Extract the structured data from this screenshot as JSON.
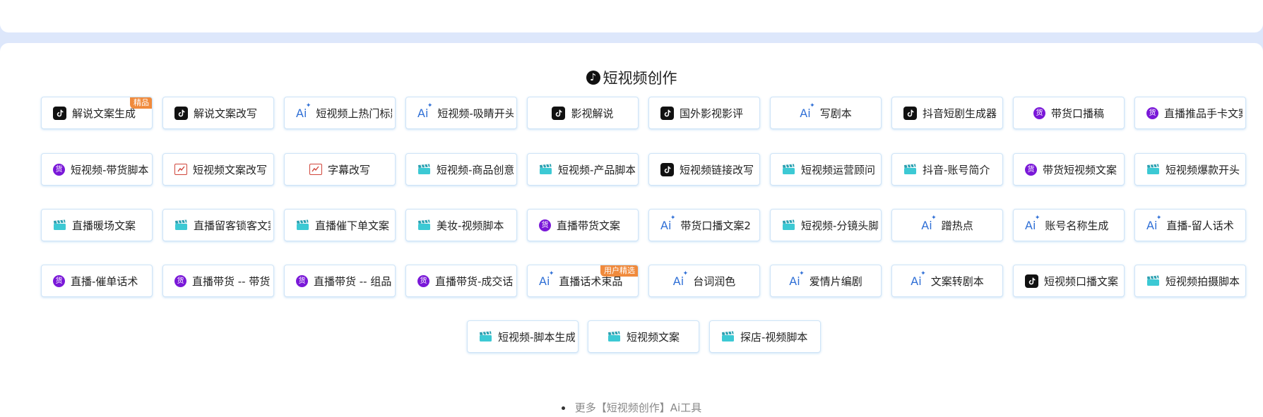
{
  "section": {
    "title": "短视频创作"
  },
  "badges": {
    "featured": "精品",
    "user_featured": "用户精选"
  },
  "tools": [
    {
      "label": "解说文案生成",
      "icon": "tiktok-icon",
      "badge": "featured"
    },
    {
      "label": "解说文案改写",
      "icon": "tiktok-icon"
    },
    {
      "label": "短视频上热门标题",
      "icon": "ai-sparkle-icon"
    },
    {
      "label": "短视频-吸睛开头",
      "icon": "ai-sparkle-icon"
    },
    {
      "label": "影视解说",
      "icon": "tiktok-icon",
      "center": true
    },
    {
      "label": "国外影视影评",
      "icon": "tiktok-icon"
    },
    {
      "label": "写剧本",
      "icon": "ai-sparkle-icon",
      "center": true
    },
    {
      "label": "抖音短剧生成器",
      "icon": "tiktok-icon"
    },
    {
      "label": "带货口播稿",
      "icon": "goods-icon",
      "center": true
    },
    {
      "label": "直播推品手卡文案",
      "icon": "goods-icon"
    },
    {
      "label": "短视频-带货脚本",
      "icon": "goods-icon"
    },
    {
      "label": "短视频文案改写",
      "icon": "edit-icon"
    },
    {
      "label": "字幕改写",
      "icon": "edit-icon",
      "center": true
    },
    {
      "label": "短视频-商品创意",
      "icon": "clapper-icon"
    },
    {
      "label": "短视频-产品脚本",
      "icon": "clapper-icon"
    },
    {
      "label": "短视频链接改写",
      "icon": "tiktok-icon"
    },
    {
      "label": "短视频运营顾问",
      "icon": "clapper-icon"
    },
    {
      "label": "抖音-账号简介",
      "icon": "clapper-icon"
    },
    {
      "label": "带货短视频文案",
      "icon": "goods-icon"
    },
    {
      "label": "短视频爆款开头",
      "icon": "clapper-icon"
    },
    {
      "label": "直播暖场文案",
      "icon": "clapper-icon"
    },
    {
      "label": "直播留客锁客文案",
      "icon": "clapper-icon"
    },
    {
      "label": "直播催下单文案",
      "icon": "clapper-icon"
    },
    {
      "label": "美妆-视频脚本",
      "icon": "clapper-icon"
    },
    {
      "label": "直播带货文案",
      "icon": "goods-icon"
    },
    {
      "label": "带货口播文案2",
      "icon": "ai-sparkle-icon"
    },
    {
      "label": "短视频-分镜头脚本",
      "icon": "clapper-icon"
    },
    {
      "label": "蹭热点",
      "icon": "ai-sparkle-icon",
      "center": true
    },
    {
      "label": "账号名称生成",
      "icon": "ai-sparkle-icon"
    },
    {
      "label": "直播-留人话术",
      "icon": "ai-sparkle-icon"
    },
    {
      "label": "直播-催单话术",
      "icon": "goods-icon"
    },
    {
      "label": "直播带货 -- 带货话术",
      "icon": "goods-icon"
    },
    {
      "label": "直播带货 -- 组品话术",
      "icon": "goods-icon"
    },
    {
      "label": "直播带货-成交话术",
      "icon": "goods-icon"
    },
    {
      "label": "直播话术束品",
      "icon": "ai-sparkle-icon",
      "badge": "user_featured"
    },
    {
      "label": "台词润色",
      "icon": "ai-sparkle-icon",
      "center": true
    },
    {
      "label": "爱情片编剧",
      "icon": "ai-sparkle-icon",
      "center": true
    },
    {
      "label": "文案转剧本",
      "icon": "ai-sparkle-icon",
      "center": true
    },
    {
      "label": "短视频口播文案",
      "icon": "tiktok-icon"
    },
    {
      "label": "短视频拍摄脚本",
      "icon": "clapper-icon"
    },
    {
      "label": "短视频-脚本生成",
      "icon": "clapper-icon"
    },
    {
      "label": "短视频文案",
      "icon": "clapper-icon",
      "center": true
    },
    {
      "label": "探店-视频脚本",
      "icon": "clapper-icon"
    }
  ],
  "footer": {
    "hint": "更多【短视频创作】Ai工具"
  }
}
